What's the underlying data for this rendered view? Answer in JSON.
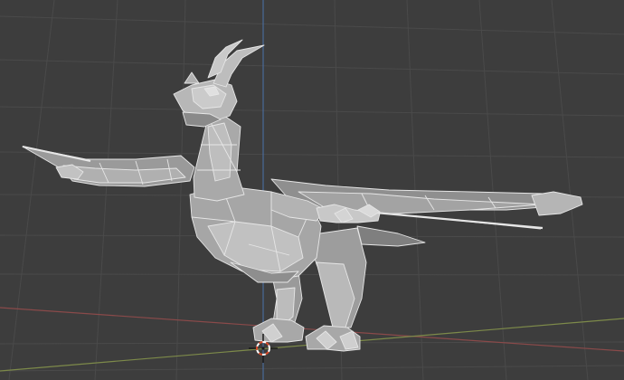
{
  "viewport": {
    "background": "#3d3d3d",
    "grid_color": "#4a4a4a",
    "axis_x_color": "#8a4a4a",
    "axis_y_color": "#7d8a4a",
    "axis_z_color": "#4a6a9a"
  },
  "object": {
    "type": "mesh",
    "subject": "dragon",
    "shading": "solid",
    "wireframe_overlay": true,
    "mesh_color": "#a9a9a9",
    "edge_color": "#e6e6e6"
  },
  "cursor": {
    "icon": "3d-cursor-icon",
    "ring_colors": [
      "#d94a2a",
      "#ffffff"
    ]
  }
}
